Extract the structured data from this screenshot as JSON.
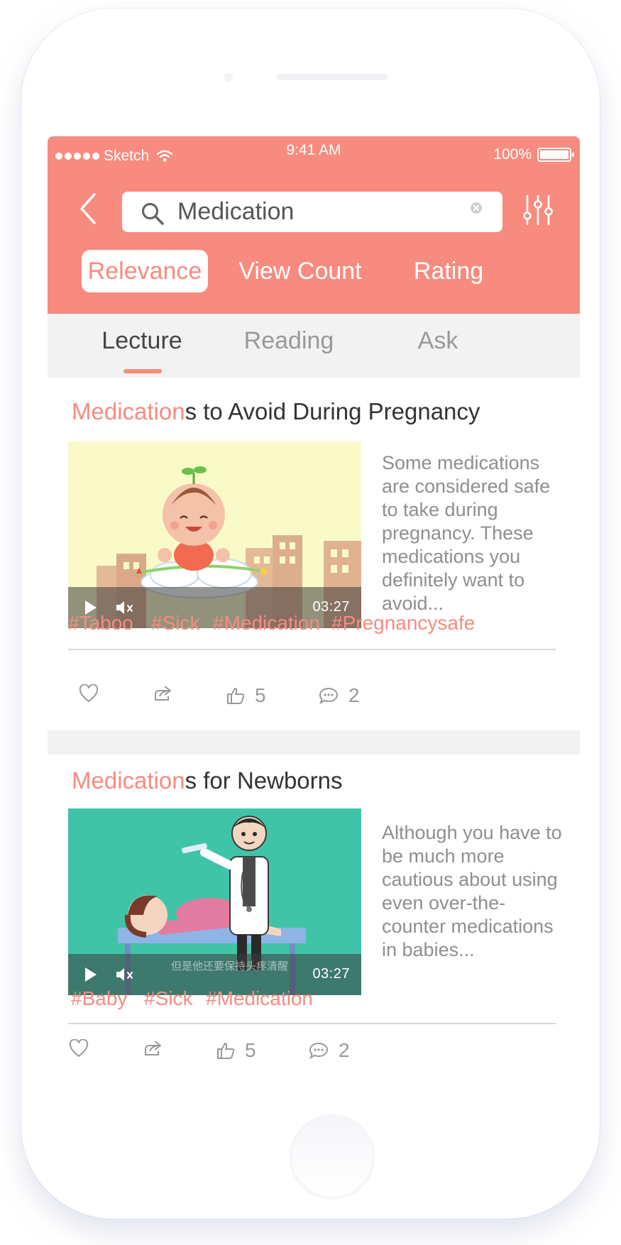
{
  "status_bar": {
    "carrier": "Sketch",
    "time": "9:41 AM",
    "battery": "100%"
  },
  "search": {
    "query": "Medication"
  },
  "sort_options": [
    {
      "label": "Relevance",
      "active": true
    },
    {
      "label": "View Count",
      "active": false
    },
    {
      "label": "Rating",
      "active": false
    }
  ],
  "tabs": [
    {
      "label": "Lecture",
      "active": true
    },
    {
      "label": "Reading",
      "active": false
    },
    {
      "label": "Ask",
      "active": false
    }
  ],
  "results": [
    {
      "title_highlight": "Medication",
      "title_rest": "s to Avoid During Pregnancy",
      "duration": "03:27",
      "description": "Some medications are considered safe to take during pregnancy. These medications you definitely want to avoid...",
      "tags": [
        "#Taboo",
        "#Sick",
        "#Medication",
        "#Pregnancysafe"
      ],
      "likes": "5",
      "comments": "2"
    },
    {
      "title_highlight": "Medication",
      "title_rest": "s for Newborns",
      "duration": "03:27",
      "subtitle_caption": "但是他还要保持头疼清醒",
      "description": "Although you have to be much more cautious about using even over-the-counter medications in babies...",
      "tags": [
        "#Baby",
        "#Sick",
        "#Medication"
      ],
      "likes": "5",
      "comments": "2"
    }
  ],
  "colors": {
    "accent": "#f88b7f",
    "tab_bg": "#f2f2f2",
    "thumb1_bg": "#fafac8",
    "thumb2_bg": "#40c4a8"
  }
}
